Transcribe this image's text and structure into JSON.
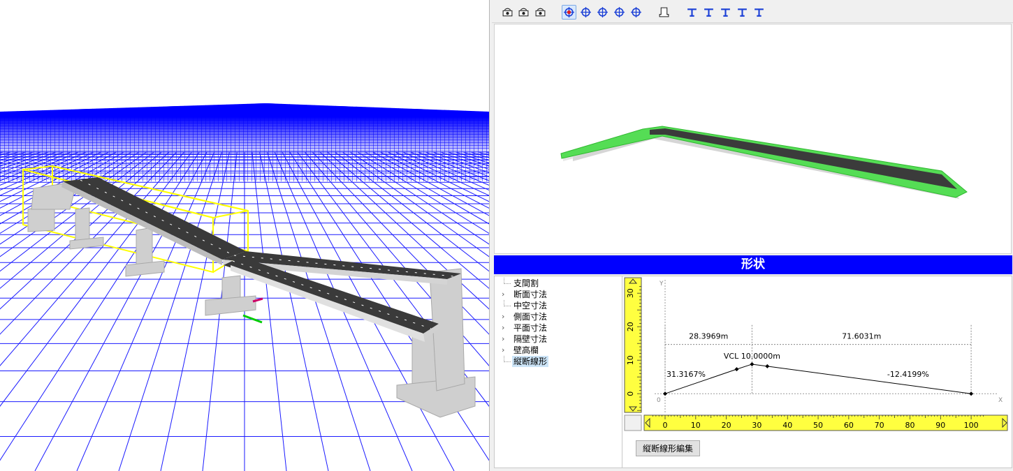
{
  "toolbar": {
    "buttons": [
      {
        "icon": "camera-rotate-icon",
        "active": false
      },
      {
        "icon": "pan-hand-icon",
        "active": false
      },
      {
        "icon": "camera-rotate-alt-icon",
        "active": false
      },
      {
        "icon": "rotate-free-icon",
        "active": true
      },
      {
        "icon": "rotate-horizontal-icon",
        "active": false
      },
      {
        "icon": "rotate-vertical-icon",
        "active": false
      },
      {
        "icon": "move-cross-icon",
        "active": false
      },
      {
        "icon": "zoom-truck-icon",
        "active": false
      },
      {
        "icon": "front-view-icon",
        "active": false
      },
      {
        "icon": "view-preset-1-icon",
        "active": false
      },
      {
        "icon": "view-preset-2-icon",
        "active": false
      },
      {
        "icon": "view-preset-3-icon",
        "active": false
      },
      {
        "icon": "view-preset-4-icon",
        "active": false
      },
      {
        "icon": "view-preset-5-icon",
        "active": false
      }
    ]
  },
  "section": {
    "title": "形状"
  },
  "tree": {
    "items": [
      {
        "label": "支間割",
        "expandable": false,
        "selected": false
      },
      {
        "label": "断面寸法",
        "expandable": true,
        "selected": false
      },
      {
        "label": "中空寸法",
        "expandable": false,
        "selected": false
      },
      {
        "label": "側面寸法",
        "expandable": true,
        "selected": false
      },
      {
        "label": "平面寸法",
        "expandable": true,
        "selected": false
      },
      {
        "label": "隔壁寸法",
        "expandable": true,
        "selected": false
      },
      {
        "label": "壁高欄",
        "expandable": true,
        "selected": false
      },
      {
        "label": "縦断線形",
        "expandable": false,
        "selected": true
      }
    ]
  },
  "chart_data": {
    "type": "line",
    "title": "",
    "xlabel": "X",
    "ylabel": "Y",
    "origin_label": "0",
    "xlim": [
      0,
      105
    ],
    "ylim": [
      -6,
      34
    ],
    "x_ticks": [
      0,
      10,
      20,
      30,
      40,
      50,
      60,
      70,
      80,
      90,
      100
    ],
    "y_ticks": [
      0,
      10,
      20,
      30
    ],
    "points": [
      {
        "x": 0,
        "y": 0
      },
      {
        "x": 23.4,
        "y": 7.3
      },
      {
        "x": 28.4,
        "y": 8.8
      },
      {
        "x": 33.4,
        "y": 8.2
      },
      {
        "x": 100,
        "y": 0
      }
    ],
    "annotations": {
      "span_left": "28.3969m",
      "span_right": "71.6031m",
      "vcl": "VCL 10.0000m",
      "grade_left": "31.3167%",
      "grade_right": "-12.4199%"
    },
    "ruler_color": "#ffff40"
  },
  "buttons": {
    "edit_profile": "縦断線形編集"
  }
}
